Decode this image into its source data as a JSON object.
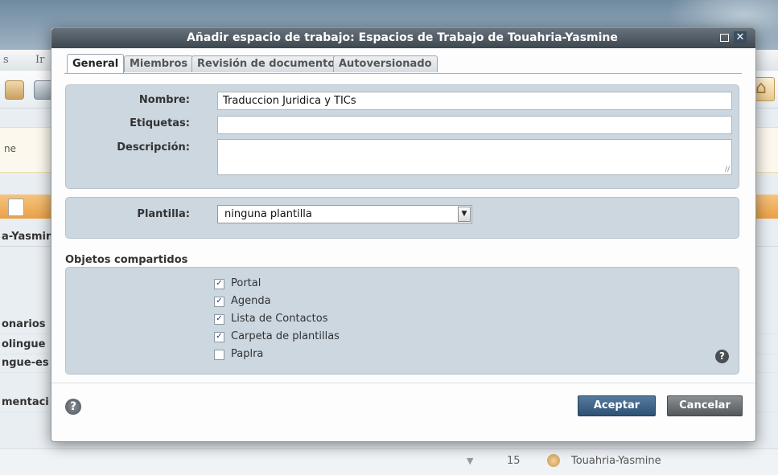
{
  "background": {
    "menu_items": [
      "s",
      "Ir"
    ],
    "notice_text": "ne",
    "tree_title": "a-Yasmin",
    "rows": [
      "onarios",
      "olingue",
      "ngue-es",
      "mentaci"
    ],
    "status_number": "15",
    "status_user": "Touahria-Yasmine"
  },
  "dialog": {
    "title": "Añadir espacio de trabajo: Espacios de Trabajo de Touahria-Yasmine",
    "tabs": [
      "General",
      "Miembros",
      "Revisión de documento",
      "Autoversionado"
    ],
    "form": {
      "name_label": "Nombre:",
      "name_value": "Traduccion Juridica y TICs",
      "tags_label": "Etiquetas:",
      "tags_value": "",
      "description_label": "Descripción:",
      "description_value": ""
    },
    "template": {
      "label": "Plantilla:",
      "value": "ninguna plantilla"
    },
    "shared_objects": {
      "title": "Objetos compartidos",
      "items": [
        {
          "label": "Portal",
          "checked": true
        },
        {
          "label": "Agenda",
          "checked": true
        },
        {
          "label": "Lista de Contactos",
          "checked": true
        },
        {
          "label": "Carpeta de plantillas",
          "checked": true
        },
        {
          "label": "Paplra",
          "checked": false
        }
      ]
    },
    "buttons": {
      "accept": "Aceptar",
      "cancel": "Cancelar"
    }
  }
}
